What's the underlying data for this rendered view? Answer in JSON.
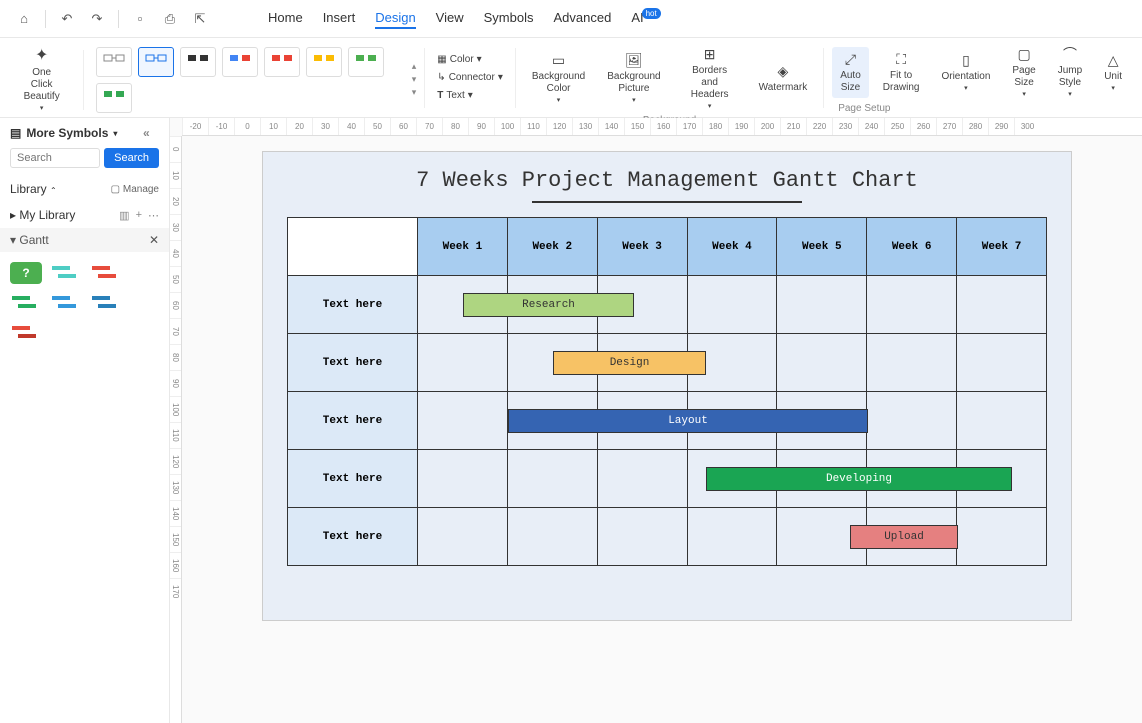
{
  "toolbar": {
    "tabs": [
      "Home",
      "Insert",
      "Design",
      "View",
      "Symbols",
      "Advanced",
      "AI"
    ],
    "active_tab": "Design",
    "hot_badge": "hot"
  },
  "ribbon": {
    "one_click": "One Click\nBeautify",
    "beautify_label": "Beautify",
    "color": "Color",
    "connector": "Connector",
    "text": "Text",
    "bg_color": "Background\nColor",
    "bg_picture": "Background\nPicture",
    "borders": "Borders and\nHeaders",
    "watermark": "Watermark",
    "background_label": "Background",
    "auto_size": "Auto\nSize",
    "fit_drawing": "Fit to\nDrawing",
    "orientation": "Orientation",
    "page_size": "Page\nSize",
    "jump_style": "Jump\nStyle",
    "unit": "Unit",
    "page_setup_label": "Page Setup"
  },
  "sidebar": {
    "more_symbols": "More Symbols",
    "search_placeholder": "Search",
    "search_btn": "Search",
    "library": "Library",
    "manage": "Manage",
    "my_library": "My Library",
    "section": "Gantt"
  },
  "ruler_h": [
    "-20",
    "-10",
    "0",
    "10",
    "20",
    "30",
    "40",
    "50",
    "60",
    "70",
    "80",
    "90",
    "100",
    "110",
    "120",
    "130",
    "140",
    "150",
    "160",
    "170",
    "180",
    "190",
    "200",
    "210",
    "220",
    "230",
    "240",
    "250",
    "260",
    "270",
    "280",
    "290",
    "300"
  ],
  "ruler_v": [
    "0",
    "10",
    "20",
    "30",
    "40",
    "50",
    "60",
    "70",
    "80",
    "90",
    "100",
    "110",
    "120",
    "130",
    "140",
    "150",
    "160",
    "170"
  ],
  "chart_data": {
    "type": "gantt",
    "title": "7 Weeks Project Management Gantt Chart",
    "columns": [
      "Week 1",
      "Week 2",
      "Week 3",
      "Week 4",
      "Week 5",
      "Week 6",
      "Week 7"
    ],
    "row_label_placeholder": "Text here",
    "bars": [
      {
        "label": "Research",
        "start": 0.5,
        "end": 2.4,
        "color": "#aed581"
      },
      {
        "label": "Design",
        "start": 1.5,
        "end": 3.2,
        "color": "#f7c265"
      },
      {
        "label": "Layout",
        "start": 1.0,
        "end": 5.0,
        "color": "#3564b2"
      },
      {
        "label": "Developing",
        "start": 3.2,
        "end": 6.6,
        "color": "#1aa553"
      },
      {
        "label": "Upload",
        "start": 4.8,
        "end": 6.0,
        "color": "#e58080"
      }
    ]
  }
}
